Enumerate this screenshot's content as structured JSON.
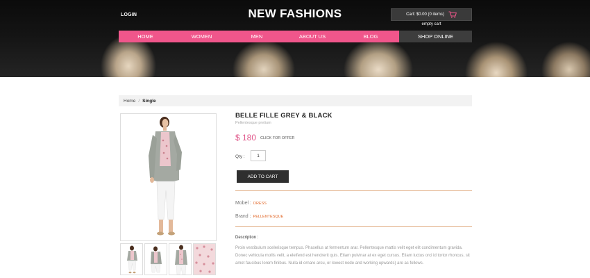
{
  "header": {
    "login": "LOGIN",
    "logo": "NEW FASHIONS",
    "cart": "Cart: $0.00 (0 items)",
    "cart_icon": "shopping-cart-icon",
    "empty_cart": "empty cart"
  },
  "nav": {
    "items": [
      {
        "label": "HOME"
      },
      {
        "label": "WOMEN"
      },
      {
        "label": "MEN"
      },
      {
        "label": "ABOUT US"
      },
      {
        "label": "BLOG"
      },
      {
        "label": "SHOP ONLINE"
      }
    ]
  },
  "breadcrumb": {
    "home": "Home",
    "separator": "/",
    "current": "Single"
  },
  "product": {
    "title": "BELLE FILLE GREY & BLACK",
    "subtitle": "Pellentesque pretium",
    "price": "$ 180",
    "offer": "CLICK FOR OFFER",
    "qty_label": "Qty :",
    "qty_value": "1",
    "add_to_cart": "ADD TO CART",
    "model_label": "Mobel :",
    "model_value": "DRESS",
    "brand_label": "Brand :",
    "brand_value": "PELLENTESQUE",
    "description_label": "Description :",
    "description": "Proin vestibulum scelerisque tempus. Phasellus at fermentum arar. Pellentesque mattis velit eget elit condimentum gravida. Donec vehicula mollis velit, a eleifend est hendrerit quis. Etiam pulvinar at ex eget cursus. Etiam luctus orci id tortor rhoncus, sit amet faucibus lorem finibus. Nulla id ornare arcu, or lowest node and working upwards) are as follows."
  },
  "colors": {
    "accent_pink": "#f0568b",
    "price_pink": "#e0578a",
    "meta_orange": "#e26a2c",
    "nav_dark": "#3d3d3d"
  }
}
